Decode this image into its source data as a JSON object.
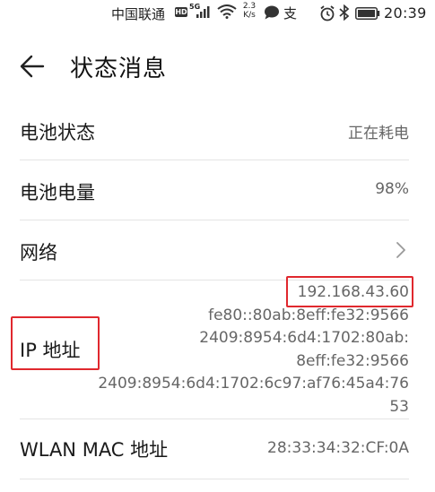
{
  "status_bar": {
    "carrier": "中国联通",
    "hd_badge": "HD",
    "network_type": "5G",
    "speed_value": "2.3",
    "speed_unit": "K/s",
    "app_glyph": "支",
    "time": "20:39",
    "icons": [
      "hd-icon",
      "signal-icon",
      "wifi-icon",
      "chat-bubble-icon",
      "alipay-icon",
      "alarm-icon",
      "bluetooth-icon",
      "battery-icon"
    ]
  },
  "header": {
    "back_icon": "arrow-left-icon",
    "title": "状态消息"
  },
  "rows": {
    "battery_status": {
      "label": "电池状态",
      "value": "正在耗电"
    },
    "battery_level": {
      "label": "电池电量",
      "value": "98%"
    },
    "network": {
      "label": "网络",
      "chevron_icon": "chevron-right-icon"
    },
    "ip": {
      "label": "IP 地址",
      "values": [
        "192.168.43.60",
        "fe80::80ab:8eff:fe32:9566",
        "2409:8954:6d4:1702:80ab:",
        "8eff:fe32:9566",
        "2409:8954:6d4:1702:6c97:af76:45a4:76",
        "53"
      ]
    },
    "wlan_mac": {
      "label": "WLAN MAC 地址",
      "value": "28:33:34:32:CF:0A"
    }
  },
  "colors": {
    "highlight": "#e0282e",
    "divider": "#e4e4e4",
    "secondary_text": "#666666"
  }
}
